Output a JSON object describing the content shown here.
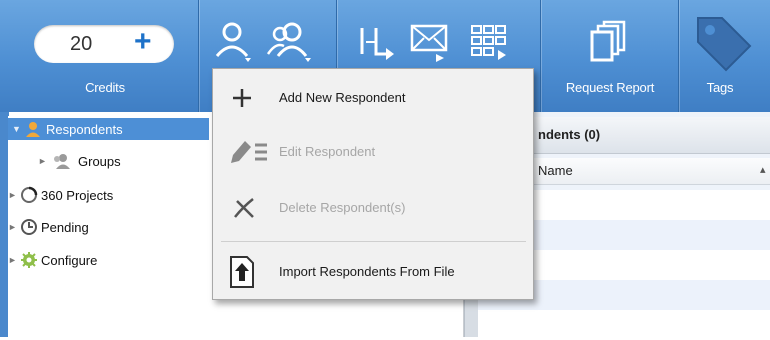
{
  "toolbar": {
    "credits_value": "20",
    "credits_plus": "+",
    "credits_label": "Credits",
    "request_report_label": "Request Report",
    "tags_label": "Tags"
  },
  "tree": {
    "items": [
      {
        "label": "Respondents"
      },
      {
        "label": "Groups"
      },
      {
        "label": "360 Projects"
      },
      {
        "label": "Pending"
      },
      {
        "label": "Configure"
      }
    ]
  },
  "grid": {
    "header_title": "ndents (0)",
    "column_name": "Name"
  },
  "menu": {
    "items": [
      {
        "label": "Add New Respondent",
        "enabled": true,
        "icon": "plus-icon"
      },
      {
        "label": "Edit Respondent",
        "enabled": false,
        "icon": "pencil-list-icon"
      },
      {
        "label": "Delete Respondent(s)",
        "enabled": false,
        "icon": "x-icon"
      },
      {
        "label": "Import Respondents From File",
        "enabled": true,
        "icon": "upload-arrow-icon"
      }
    ]
  },
  "colors": {
    "toolbar_blue": "#4e8fd3",
    "selected_blue": "#4d8fd6",
    "accent_plus": "#1e72c9"
  }
}
